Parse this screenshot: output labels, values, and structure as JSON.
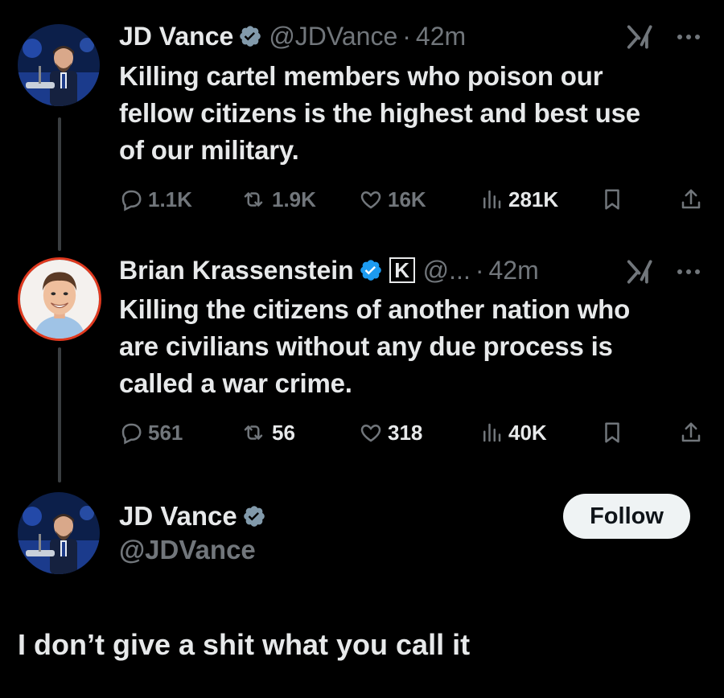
{
  "colors": {
    "background": "#000000",
    "primary_text": "#e7e9ea",
    "secondary_text": "#71767b",
    "verified_blue": "#1d9bf0",
    "verified_gray": "#829aab",
    "thread_line": "#3a3e41"
  },
  "tweets": [
    {
      "author_name": "JD Vance",
      "handle": "@JDVance",
      "separator": "·",
      "time": "42m",
      "text_lines": [
        "Killing cartel members who poison our",
        "fellow citizens is the highest and best use",
        "of our military."
      ],
      "stats": {
        "replies": "1.1K",
        "reposts": "1.9K",
        "likes": "16K",
        "views": "281K"
      },
      "icons": [
        "verified-badge-gray",
        "grok-icon",
        "more-icon"
      ]
    },
    {
      "author_name": "Brian Krassenstein",
      "handle": "@...",
      "separator": "·",
      "time": "42m",
      "affiliate_badge": "K",
      "text_lines": [
        "Killing the citizens of another nation who",
        "are civilians without any due process is",
        "called a war crime."
      ],
      "stats": {
        "replies": "561",
        "reposts": "56",
        "likes": "318",
        "views": "40K"
      },
      "icons": [
        "verified-badge-blue",
        "grok-icon",
        "more-icon"
      ]
    }
  ],
  "reply": {
    "author_name": "JD Vance",
    "handle": "@JDVance",
    "follow_label": "Follow",
    "text": "I don’t give a shit what you call it"
  }
}
